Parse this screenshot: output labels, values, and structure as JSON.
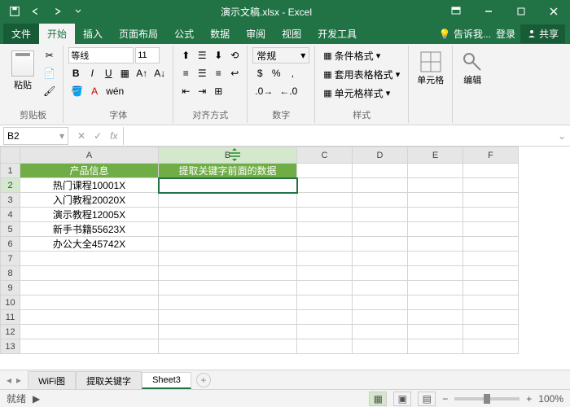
{
  "title": "演示文稿.xlsx - Excel",
  "qat": {
    "save": "save",
    "undo": "undo",
    "redo": "redo"
  },
  "menu": {
    "file": "文件",
    "home": "开始",
    "insert": "插入",
    "layout": "页面布局",
    "formula": "公式",
    "data": "数据",
    "review": "审阅",
    "view": "视图",
    "dev": "开发工具",
    "tell": "告诉我...",
    "login": "登录",
    "share": "共享"
  },
  "ribbon": {
    "clipboard": {
      "label": "剪贴板",
      "paste": "粘贴"
    },
    "font": {
      "label": "字体",
      "name": "等线",
      "size": "11",
      "bold": "B",
      "italic": "I",
      "underline": "U"
    },
    "align": {
      "label": "对齐方式"
    },
    "number": {
      "label": "数字",
      "format": "常规"
    },
    "styles": {
      "label": "样式",
      "cond": "条件格式",
      "table": "套用表格格式",
      "cell": "单元格样式"
    },
    "cells": {
      "label": "单元格"
    },
    "editing": {
      "label": "编辑"
    }
  },
  "formula": {
    "cellref": "B2",
    "fx": "fx"
  },
  "columns": [
    "A",
    "B",
    "C",
    "D",
    "E",
    "F"
  ],
  "rows": [
    "1",
    "2",
    "3",
    "4",
    "5",
    "6",
    "7",
    "8",
    "9",
    "10",
    "11",
    "12",
    "13"
  ],
  "headers": {
    "A": "产品信息",
    "B": "提取关键字前面的数据"
  },
  "data": {
    "A2": "热门课程10001X",
    "A3": "入门教程20020X",
    "A4": "演示教程12005X",
    "A5": "新手书籍55623X",
    "A6": "办公大全45742X"
  },
  "sheets": {
    "s1": "WiFi图",
    "s2": "提取关键字",
    "s3": "Sheet3"
  },
  "status": {
    "ready": "就绪",
    "zoom": "100%"
  }
}
